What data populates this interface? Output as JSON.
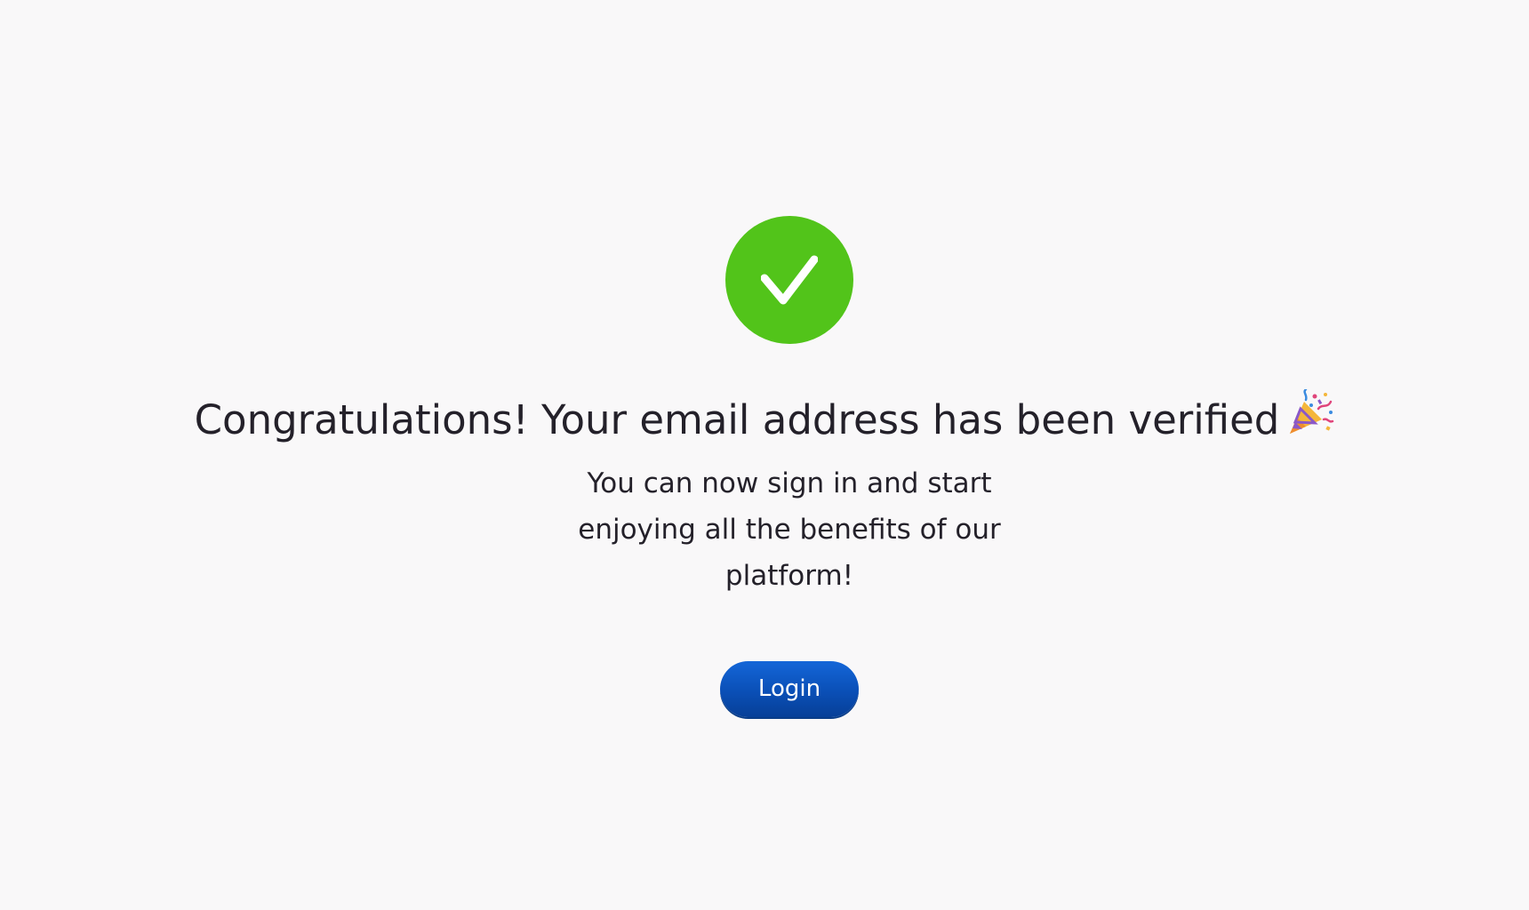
{
  "colors": {
    "background": "#f9f8f9",
    "success": "#52c41a",
    "button": "#0a4fb6",
    "text": "#24212a"
  },
  "status_icon": "check-icon",
  "title": "Congratulations! Your email address has been verified",
  "title_emoji_icon": "party-popper-icon",
  "subtitle": "You can now sign in and start enjoying all the benefits of our platform!",
  "login_button_label": "Login"
}
